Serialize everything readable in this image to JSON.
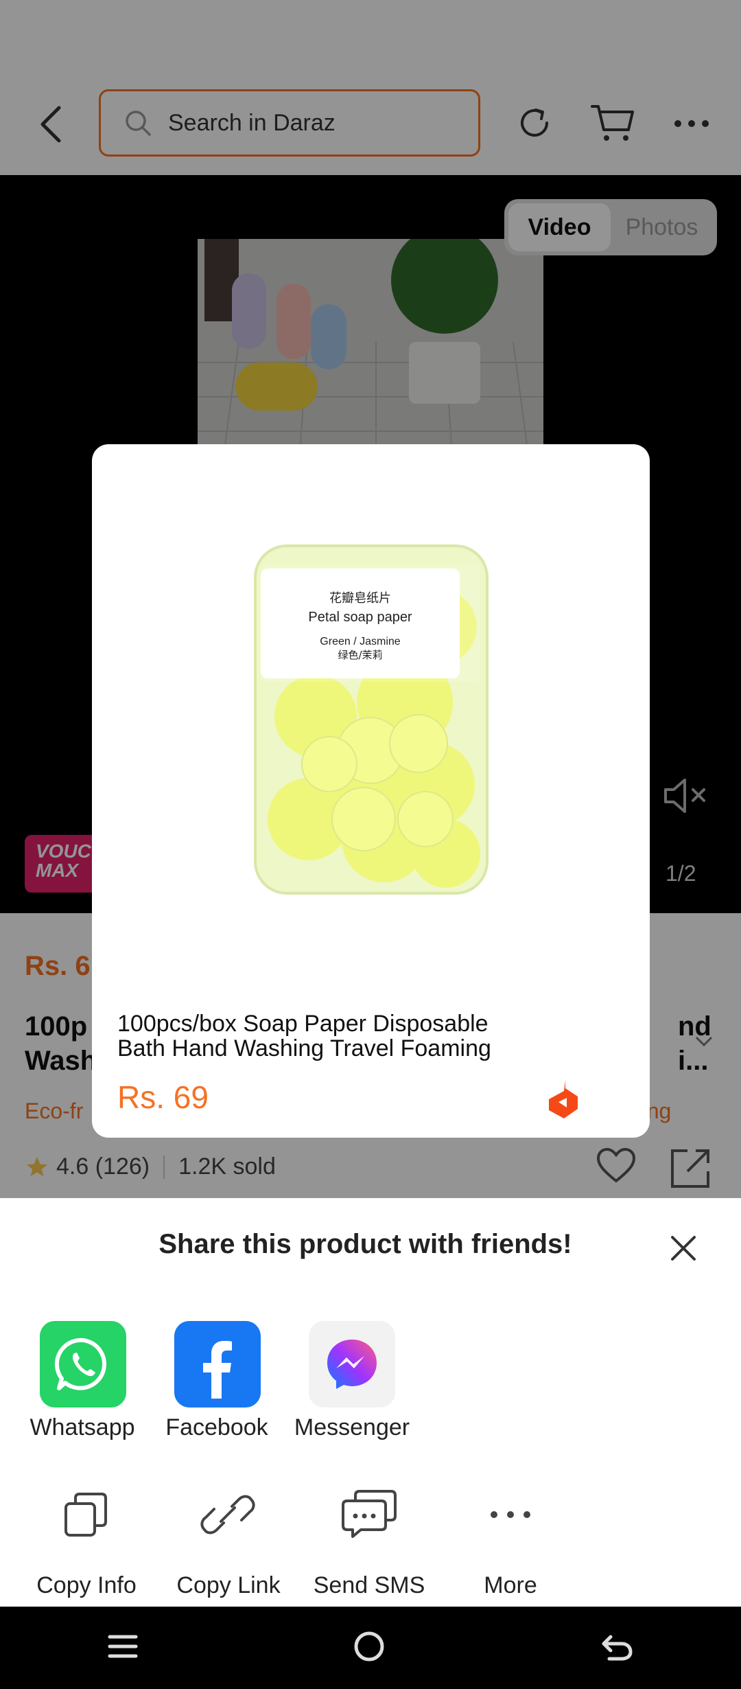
{
  "header": {
    "search_placeholder": "Search in Daraz"
  },
  "media": {
    "toggle": [
      "Video",
      "Photos"
    ],
    "active_toggle": "Video",
    "voucher_badge": "VOUC MAX",
    "counter": "1/2"
  },
  "product_page": {
    "price_partial": "Rs. 6",
    "title_line1_partial": "100p",
    "title_line1_right": "nd",
    "title_line2_partial": "Wash",
    "title_line2_right": "i...",
    "tag_left_partial": "Eco-fr",
    "tag_right_partial": "aning",
    "rating": "4.6 (126)",
    "sold": "1.2K sold"
  },
  "share_card": {
    "image_text": {
      "line1": "花瓣皂纸片",
      "line2": "Petal soap paper",
      "line3": "Green / Jasmine",
      "line4": "绿色/茉莉"
    },
    "title_line1": "100pcs/box Soap Paper Disposable",
    "title_line2": "Bath Hand Washing Travel Foaming",
    "price": "Rs. 69"
  },
  "share_sheet": {
    "title": "Share this product with friends!",
    "apps": [
      {
        "label": "Whatsapp",
        "icon": "whatsapp-icon",
        "color": "#25d366"
      },
      {
        "label": "Facebook",
        "icon": "facebook-icon",
        "color": "#1877f2"
      },
      {
        "label": "Messenger",
        "icon": "messenger-icon",
        "color": "#f2f2f2"
      }
    ],
    "actions": [
      {
        "label": "Copy Info",
        "icon": "copy-icon"
      },
      {
        "label": "Copy Link",
        "icon": "link-icon"
      },
      {
        "label": "Send SMS",
        "icon": "sms-icon"
      },
      {
        "label": "More",
        "icon": "more-icon"
      }
    ]
  },
  "colors": {
    "brand": "#f57224",
    "voucher": "#e3226b"
  }
}
